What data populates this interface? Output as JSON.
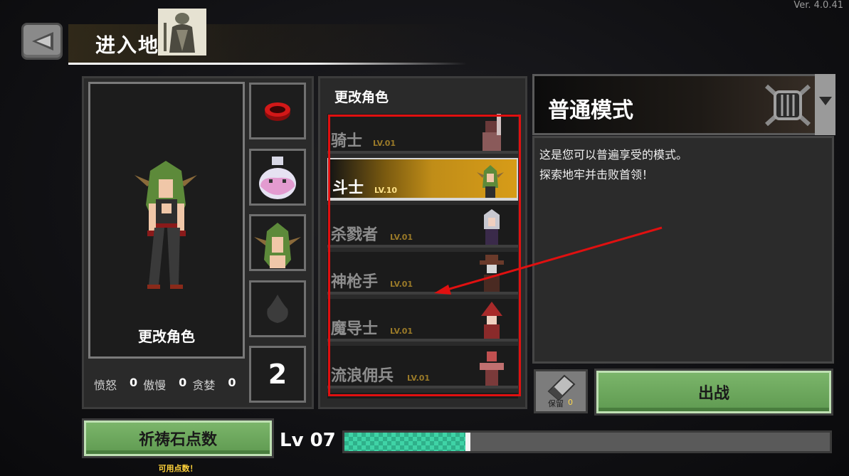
{
  "version": "Ver. 4.0.41",
  "header": {
    "title": "进入地"
  },
  "left": {
    "change_label": "更改角色",
    "slot_count": "2",
    "stats": [
      {
        "label": "愤怒",
        "value": "0"
      },
      {
        "label": "傲慢",
        "value": "0"
      },
      {
        "label": "贪婪",
        "value": "0"
      }
    ]
  },
  "characters": {
    "heading": "更改角色",
    "items": [
      {
        "name": "骑士",
        "level": "LV.01"
      },
      {
        "name": "斗士",
        "level": "LV.10",
        "selected": true
      },
      {
        "name": "杀戮者",
        "level": "LV.01"
      },
      {
        "name": "神枪手",
        "level": "LV.01"
      },
      {
        "name": "魔导士",
        "level": "LV.01"
      },
      {
        "name": "流浪佣兵",
        "level": "LV.01"
      }
    ]
  },
  "mode": {
    "title": "普通模式",
    "desc_line1": "这是您可以普遍享受的模式。",
    "desc_line2": "探索地牢并击败首领！"
  },
  "keep": {
    "label": "保留",
    "count": "0"
  },
  "buttons": {
    "go": "出战",
    "pray": "祈祷石点数",
    "available": "可用点数！"
  },
  "level": {
    "label": "Lv 07",
    "progress": 0.26
  },
  "colors": {
    "accent_gold": "#d79c18",
    "xp_green": "#3fd3a6",
    "highlight_red": "#e01010",
    "button_green": "#6fa85f"
  }
}
